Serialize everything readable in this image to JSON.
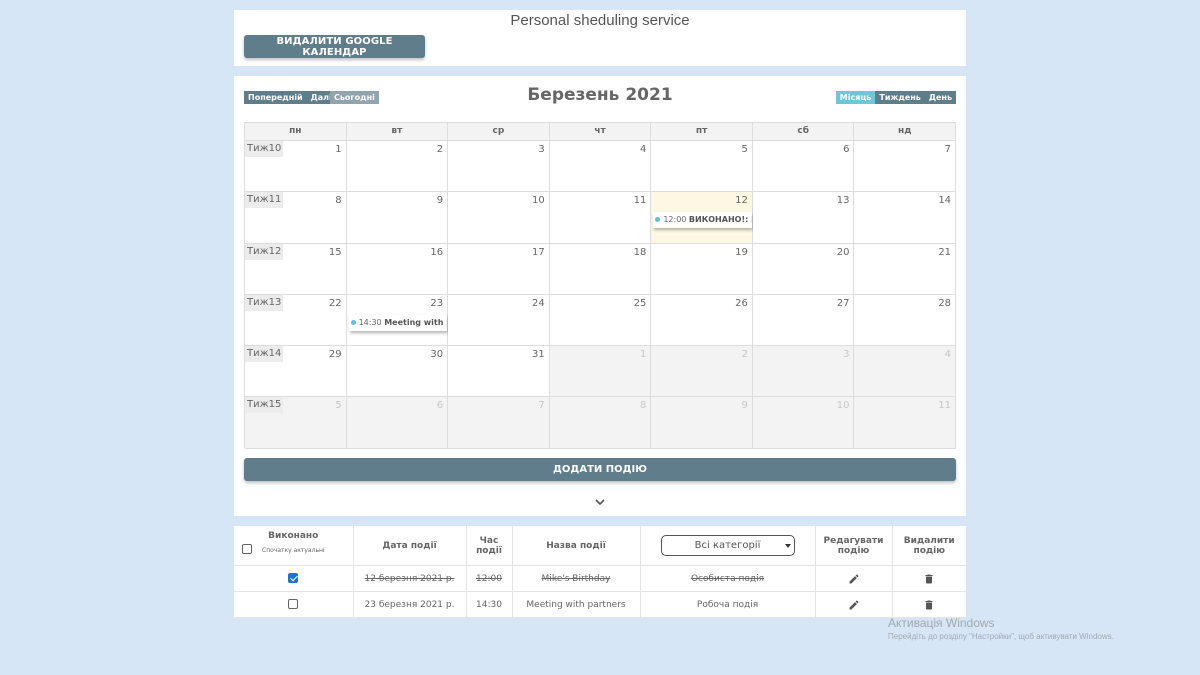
{
  "header": {
    "title": "Personal sheduling service",
    "delete_google_label": "ВИДАЛИТИ GOOGLE КАЛЕНДАР"
  },
  "calendar": {
    "title": "Березень 2021",
    "nav": {
      "prev": "Попередній",
      "next": "Далі",
      "today": "Сьогодні"
    },
    "views": {
      "month": "Місяць",
      "week": "Тиждень",
      "day": "День",
      "active": "month"
    },
    "days_of_week": [
      "пн",
      "вт",
      "ср",
      "чт",
      "пт",
      "сб",
      "нд"
    ],
    "weeks": [
      {
        "label": "Тиж10",
        "days": [
          {
            "num": "1"
          },
          {
            "num": "2"
          },
          {
            "num": "3"
          },
          {
            "num": "4"
          },
          {
            "num": "5"
          },
          {
            "num": "6"
          },
          {
            "num": "7"
          }
        ]
      },
      {
        "label": "Тиж11",
        "days": [
          {
            "num": "8"
          },
          {
            "num": "9"
          },
          {
            "num": "10"
          },
          {
            "num": "11"
          },
          {
            "num": "12",
            "today": true,
            "event": {
              "time": "12:00",
              "title": "ВИКОНАНО!: M"
            }
          },
          {
            "num": "13"
          },
          {
            "num": "14"
          }
        ]
      },
      {
        "label": "Тиж12",
        "days": [
          {
            "num": "15"
          },
          {
            "num": "16"
          },
          {
            "num": "17"
          },
          {
            "num": "18"
          },
          {
            "num": "19"
          },
          {
            "num": "20"
          },
          {
            "num": "21"
          }
        ]
      },
      {
        "label": "Тиж13",
        "days": [
          {
            "num": "22"
          },
          {
            "num": "23",
            "event": {
              "time": "14:30",
              "title": "Meeting with pa"
            }
          },
          {
            "num": "24"
          },
          {
            "num": "25"
          },
          {
            "num": "26"
          },
          {
            "num": "27"
          },
          {
            "num": "28"
          }
        ]
      },
      {
        "label": "Тиж14",
        "days": [
          {
            "num": "29"
          },
          {
            "num": "30"
          },
          {
            "num": "31"
          },
          {
            "num": "1",
            "other": true
          },
          {
            "num": "2",
            "other": true
          },
          {
            "num": "3",
            "other": true
          },
          {
            "num": "4",
            "other": true
          }
        ]
      },
      {
        "label": "Тиж15",
        "days": [
          {
            "num": "5",
            "other": true
          },
          {
            "num": "6",
            "other": true
          },
          {
            "num": "7",
            "other": true
          },
          {
            "num": "8",
            "other": true
          },
          {
            "num": "9",
            "other": true
          },
          {
            "num": "10",
            "other": true
          },
          {
            "num": "11",
            "other": true
          }
        ]
      }
    ],
    "add_event_label": "ДОДАТИ ПОДІЮ",
    "expand_icon": "chevron-down-icon"
  },
  "events_table": {
    "headers": {
      "done": "Виконано",
      "done_sub": "Спочатку актуальні",
      "date": "Дата події",
      "time": "Час події",
      "name": "Назва події",
      "category_select": "Всі категорії",
      "edit": "Редагувати подію",
      "delete": "Видалити подію"
    },
    "rows": [
      {
        "done": true,
        "date": "12 березня 2021 р.",
        "time": "12:00",
        "name": "Mike's Birthday",
        "category": "Особиста подія"
      },
      {
        "done": false,
        "date": "23 березня 2021 р.",
        "time": "14:30",
        "name": "Meeting with partners",
        "category": "Робоча подія"
      }
    ]
  },
  "watermark": {
    "line1": "Активація Windows",
    "line2": "Перейдіть до розділу \"Настройки\", щоб активувати Windows."
  },
  "colors": {
    "background": "#d6e6f6",
    "button": "#607d8b",
    "active_view": "#6ec6d9",
    "today_cell": "#fcf8e3",
    "event_dot": "#5bc0de",
    "checkbox_checked": "#1976d2"
  }
}
